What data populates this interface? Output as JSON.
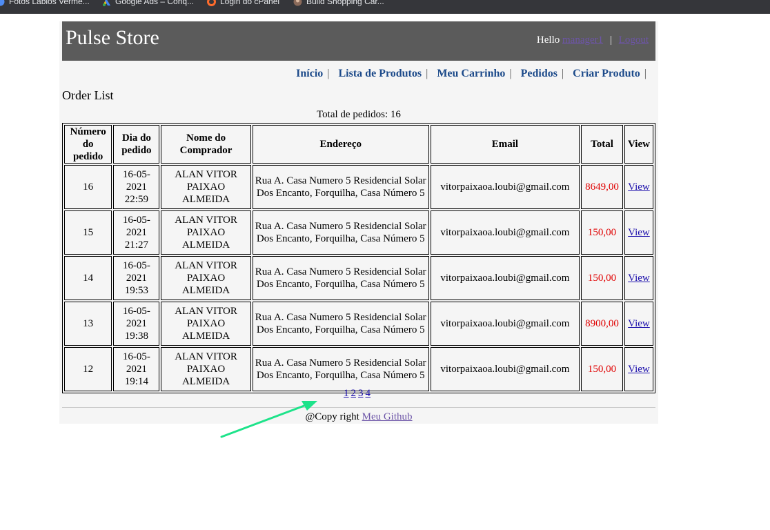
{
  "bookmarks": [
    {
      "label": "Fotos Lábios Verme...",
      "icon": "globe-icon"
    },
    {
      "label": "Google Ads – Conq...",
      "icon": "google-ads-icon"
    },
    {
      "label": "Login do cPanel",
      "icon": "cpanel-icon"
    },
    {
      "label": "Build Shopping Car...",
      "icon": "avatar-icon"
    }
  ],
  "header": {
    "brand": "Pulse Store",
    "hello": "Hello",
    "user": "manager1",
    "separator": "|",
    "logout": "Logout"
  },
  "menu": {
    "items": [
      "Início",
      "Lista de Produtos",
      "Meu Carrinho",
      "Pedidos",
      "Criar Produto"
    ],
    "separator": "|"
  },
  "order_title": "Order List",
  "total_label": "Total de pedidos: 16",
  "table": {
    "headers": [
      "Número do pedido",
      "Dia do pedido",
      "Nome do Comprador",
      "Endereço",
      "Email",
      "Total",
      "View"
    ],
    "rows": [
      {
        "num": "16",
        "date": "16-05-2021 22:59",
        "name": "ALAN VITOR PAIXAO ALMEIDA",
        "address": "Rua A. Casa Numero 5 Residencial Solar Dos Encanto, Forquilha, Casa Número 5",
        "email": "vitorpaixaoa.loubi@gmail.com",
        "total": "8649,00",
        "view": "View"
      },
      {
        "num": "15",
        "date": "16-05-2021 21:27",
        "name": "ALAN VITOR PAIXAO ALMEIDA",
        "address": "Rua A. Casa Numero 5 Residencial Solar Dos Encanto, Forquilha, Casa Número 5",
        "email": "vitorpaixaoa.loubi@gmail.com",
        "total": "150,00",
        "view": "View"
      },
      {
        "num": "14",
        "date": "16-05-2021 19:53",
        "name": "ALAN VITOR PAIXAO ALMEIDA",
        "address": "Rua A. Casa Numero 5 Residencial Solar Dos Encanto, Forquilha, Casa Número 5",
        "email": "vitorpaixaoa.loubi@gmail.com",
        "total": "150,00",
        "view": "View"
      },
      {
        "num": "13",
        "date": "16-05-2021 19:38",
        "name": "ALAN VITOR PAIXAO ALMEIDA",
        "address": "Rua A. Casa Numero 5 Residencial Solar Dos Encanto, Forquilha, Casa Número 5",
        "email": "vitorpaixaoa.loubi@gmail.com",
        "total": "8900,00",
        "view": "View"
      },
      {
        "num": "12",
        "date": "16-05-2021 19:14",
        "name": "ALAN VITOR PAIXAO ALMEIDA",
        "address": "Rua A. Casa Numero 5 Residencial Solar Dos Encanto, Forquilha, Casa Número 5",
        "email": "vitorpaixaoa.loubi@gmail.com",
        "total": "150,00",
        "view": "View"
      }
    ]
  },
  "pagination": [
    "1",
    "2",
    "3",
    "4"
  ],
  "footer": {
    "text": "@Copy right",
    "link": "Meu Github"
  },
  "colors": {
    "header_bg": "#5b5b5b",
    "menu_link": "#1c4a8a",
    "total_red": "#e00000",
    "arrow": "#1de38a"
  }
}
